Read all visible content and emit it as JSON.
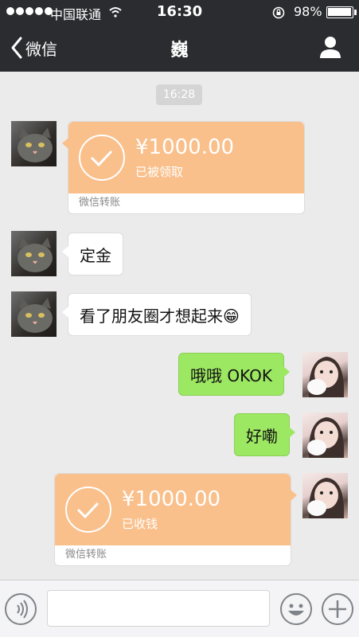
{
  "status_bar": {
    "carrier": "中国联通",
    "time": "16:30",
    "battery": "98%"
  },
  "nav": {
    "back_label": "微信",
    "title": "巍"
  },
  "chat": {
    "timestamp": "16:28",
    "messages": [
      {
        "from": "other",
        "type": "transfer",
        "amount": "¥1000.00",
        "status": "已被领取",
        "footer": "微信转账"
      },
      {
        "from": "other",
        "type": "text",
        "text": "定金"
      },
      {
        "from": "other",
        "type": "text",
        "text": "看了朋友圈才想起来😁"
      },
      {
        "from": "me",
        "type": "text",
        "text": "哦哦 OKOK"
      },
      {
        "from": "me",
        "type": "text",
        "text": "好嘞"
      },
      {
        "from": "me",
        "type": "transfer",
        "amount": "¥1000.00",
        "status": "已收钱",
        "footer": "微信转账"
      }
    ]
  },
  "input_bar": {
    "text_value": ""
  },
  "icons": {
    "back": "chevron-left-icon",
    "profile": "person-icon",
    "voice": "voice-icon",
    "emoji": "emoji-icon",
    "more": "plus-icon"
  },
  "colors": {
    "header": "#2b2c30",
    "background": "#ebebeb",
    "my_bubble": "#9de862",
    "transfer": "#f9c08c"
  }
}
